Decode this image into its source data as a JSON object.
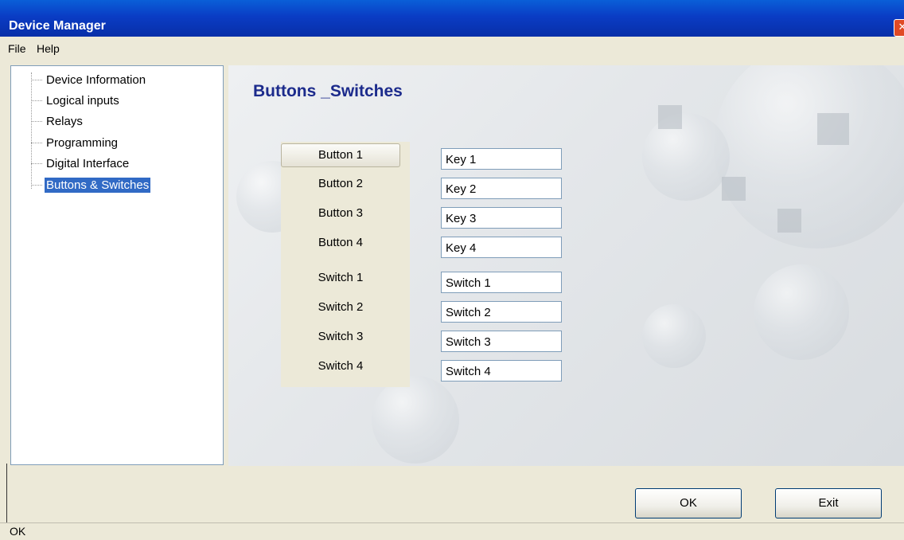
{
  "window": {
    "title": "Device Manager",
    "close_icon": "close-icon"
  },
  "menu": {
    "items": [
      {
        "label": "File"
      },
      {
        "label": "Help"
      }
    ]
  },
  "tree": {
    "items": [
      {
        "label": "Device Information"
      },
      {
        "label": "Logical inputs"
      },
      {
        "label": "Relays"
      },
      {
        "label": "Programming"
      },
      {
        "label": "Digital Interface"
      },
      {
        "label": "Buttons & Switches",
        "selected": true
      }
    ]
  },
  "content": {
    "title": "Buttons _Switches",
    "rows": [
      {
        "label": "Button 1",
        "value": "Key 1"
      },
      {
        "label": "Button 2",
        "value": "Key 2"
      },
      {
        "label": "Button 3",
        "value": "Key 3"
      },
      {
        "label": "Button 4",
        "value": "Key 4"
      },
      {
        "label": "Switch 1",
        "value": "Switch 1"
      },
      {
        "label": "Switch 2",
        "value": "Switch 2"
      },
      {
        "label": "Switch 3",
        "value": "Switch 3"
      },
      {
        "label": "Switch 4",
        "value": "Switch 4"
      }
    ]
  },
  "footer": {
    "ok_label": "OK",
    "exit_label": "Exit"
  },
  "status": {
    "text": "OK"
  },
  "colors": {
    "title_bar": "#0a3cc4",
    "selection": "#316ac5",
    "heading": "#1c2b8c"
  }
}
